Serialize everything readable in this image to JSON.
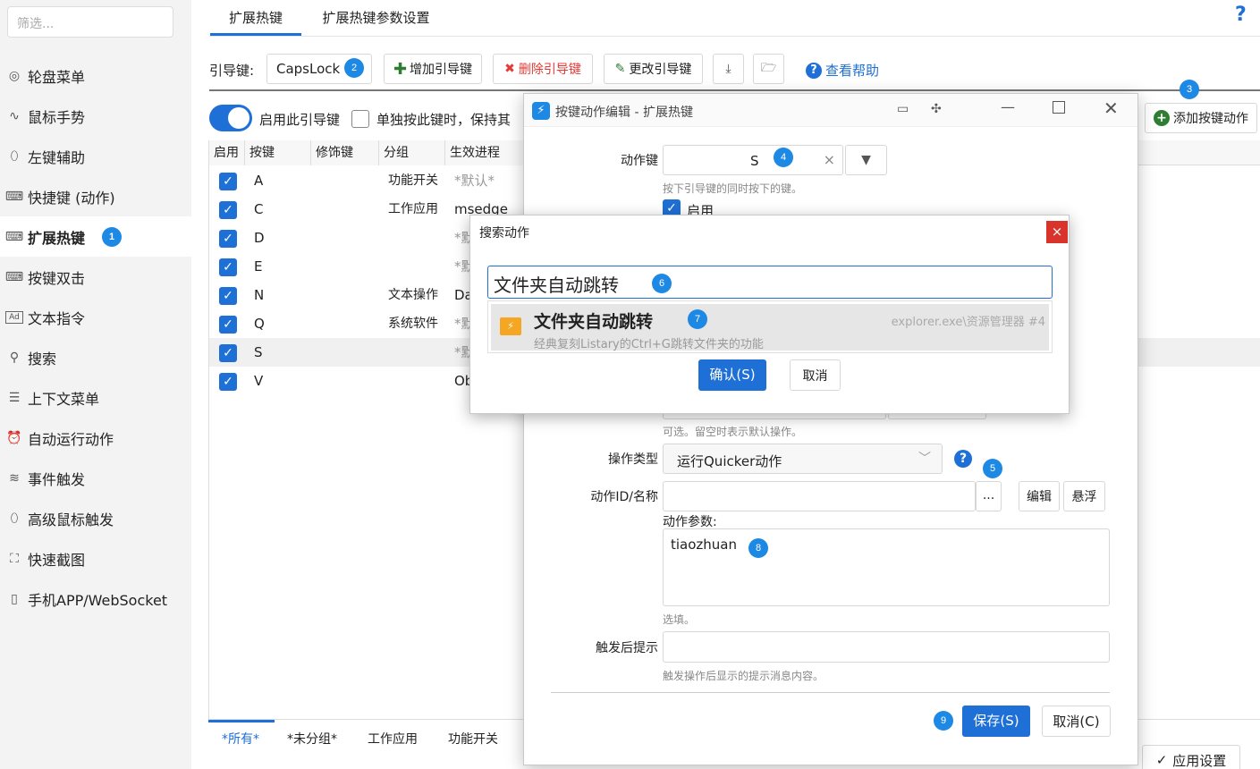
{
  "sidebar": {
    "filter_placeholder": "筛选...",
    "items": [
      {
        "label": "轮盘菜单",
        "icon": "wheel-icon"
      },
      {
        "label": "鼠标手势",
        "icon": "gesture-icon"
      },
      {
        "label": "左键辅助",
        "icon": "mouse-icon"
      },
      {
        "label": "快捷键 (动作)",
        "icon": "keyboard-icon"
      },
      {
        "label": "扩展热键",
        "icon": "keyboard-icon",
        "badge": "1"
      },
      {
        "label": "按键双击",
        "icon": "keyboard-icon"
      },
      {
        "label": "文本指令",
        "icon": "text-ad-icon"
      },
      {
        "label": "搜索",
        "icon": "search-icon"
      },
      {
        "label": "上下文菜单",
        "icon": "menu-icon"
      },
      {
        "label": "自动运行动作",
        "icon": "alarm-icon"
      },
      {
        "label": "事件触发",
        "icon": "event-icon"
      },
      {
        "label": "高级鼠标触发",
        "icon": "mouse-icon"
      },
      {
        "label": "快速截图",
        "icon": "screenshot-icon"
      },
      {
        "label": "手机APP/WebSocket",
        "icon": "phone-icon"
      }
    ]
  },
  "main": {
    "tabs": [
      "扩展热键",
      "扩展热键参数设置"
    ],
    "help_icon": "?",
    "lead_key_label": "引导键:",
    "lead_key_value": "CapsLock",
    "badge2": "2",
    "add_lead": "增加引导键",
    "del_lead": "删除引导键",
    "edit_lead": "更改引导键",
    "view_help": "查看帮助",
    "enable_lead": "启用此引导键",
    "single_press": "单独按此键时，保持其",
    "add_action": "添加按键动作",
    "badge3": "3",
    "columns": [
      "启用",
      "按键",
      "修饰键",
      "分组",
      "生效进程"
    ],
    "rows": [
      {
        "key": "A",
        "mod": "",
        "group": "功能开关",
        "proc": "*默认*"
      },
      {
        "key": "C",
        "mod": "",
        "group": "工作应用",
        "proc": "msedge"
      },
      {
        "key": "D",
        "mod": "",
        "group": "",
        "proc": "*默"
      },
      {
        "key": "E",
        "mod": "",
        "group": "",
        "proc": "*默"
      },
      {
        "key": "N",
        "mod": "",
        "group": "文本操作",
        "proc": "Da"
      },
      {
        "key": "Q",
        "mod": "",
        "group": "系统软件",
        "proc": "*默"
      },
      {
        "key": "S",
        "mod": "",
        "group": "",
        "proc": "*默"
      },
      {
        "key": "V",
        "mod": "",
        "group": "",
        "proc": "Ob"
      }
    ],
    "bottom_tabs": [
      "*所有*",
      "*未分组*",
      "工作应用",
      "功能开关"
    ],
    "apply_settings": "应用设置"
  },
  "editor": {
    "title": "按键动作编辑 - 扩展热键",
    "action_key_label": "动作键",
    "action_key_value": "S",
    "badge4": "4",
    "action_key_hint": "按下引导键的同时按下的键。",
    "enable_label": "启用",
    "optional_hint": "可选。留空时表示默认操作。",
    "op_type_label": "操作类型",
    "op_type_value": "运行Quicker动作",
    "badge5": "5",
    "action_id_label": "动作ID/名称",
    "ellipsis": "...",
    "edit_btn": "编辑",
    "float_btn": "悬浮",
    "params_label": "动作参数:",
    "params_value": "tiaozhuan",
    "badge8": "8",
    "params_hint": "选填。",
    "after_label": "触发后提示",
    "after_hint": "触发操作后显示的提示消息内容。",
    "badge9": "9",
    "save_btn": "保存(S)",
    "cancel_btn": "取消(C)"
  },
  "search": {
    "title": "搜索动作",
    "close": "×",
    "query": "文件夹自动跳转",
    "badge6": "6",
    "result_title": "文件夹自动跳转",
    "badge7": "7",
    "result_desc": "经典复刻Listary的Ctrl+G跳转文件夹的功能",
    "result_source": "explorer.exe\\资源管理器 #4",
    "ok_btn": "确认(S)",
    "cancel_btn": "取消"
  },
  "colors": {
    "accent": "#1e6fd6",
    "badge": "#1e88e5",
    "danger": "#e53935",
    "green": "#2e7d32",
    "close_red": "#d9342b"
  }
}
